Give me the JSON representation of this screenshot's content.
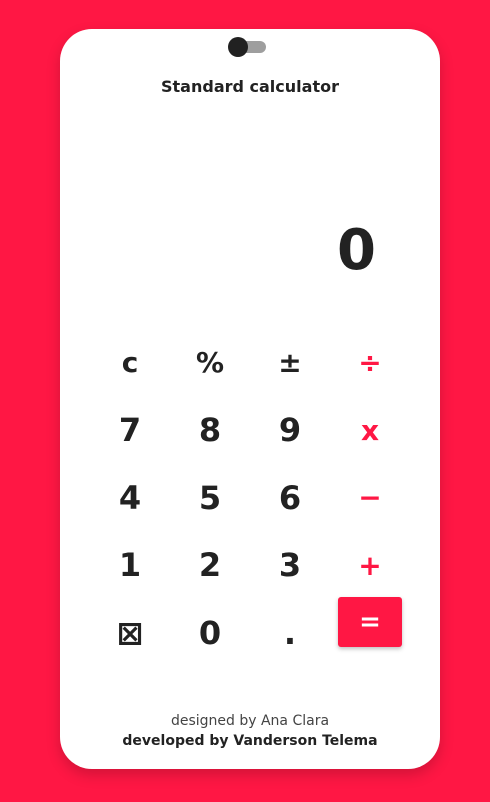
{
  "theme": {
    "accent": "#ff1744",
    "background": "#ff1744",
    "card": "#ffffff",
    "text": "#222222"
  },
  "header": {
    "title": "Standard calculator",
    "theme_toggle": {
      "state": "off"
    }
  },
  "display": {
    "value": "0"
  },
  "keypad": {
    "clear": "c",
    "percent": "%",
    "sign": "±",
    "divide": "÷",
    "seven": "7",
    "eight": "8",
    "nine": "9",
    "multiply": "x",
    "four": "4",
    "five": "5",
    "six": "6",
    "subtract": "−",
    "one": "1",
    "two": "2",
    "three": "3",
    "add": "+",
    "backspace": "⊠",
    "zero": "0",
    "decimal": ".",
    "equals": "="
  },
  "footer": {
    "designed_by": "designed by Ana Clara",
    "developed_by": "developed by Vanderson Telema"
  }
}
